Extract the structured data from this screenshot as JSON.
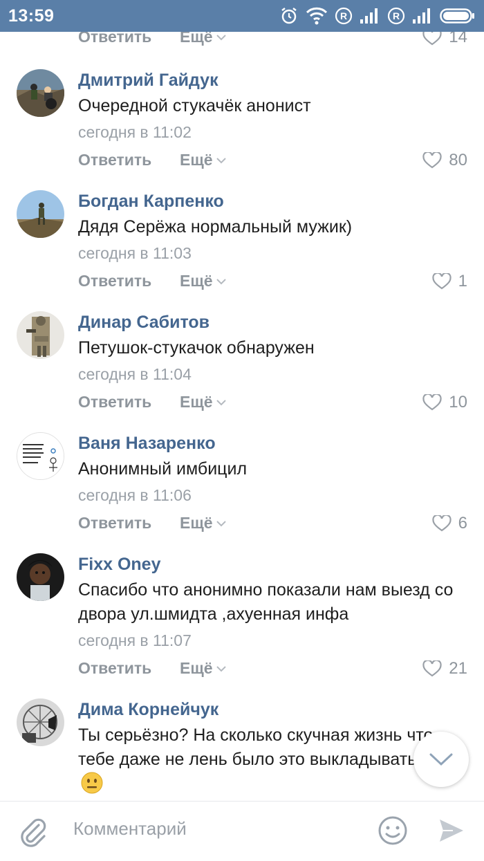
{
  "status_bar": {
    "time": "13:59"
  },
  "top_partial": {
    "reply": "Ответить",
    "more": "Ещё",
    "likes": "14"
  },
  "comments": [
    {
      "author": "Дмитрий Гайдук",
      "text": "Очередной стукачёк анонист",
      "date": "сегодня в 11:02",
      "reply": "Ответить",
      "more": "Ещё",
      "likes": "80"
    },
    {
      "author": "Богдан Карпенко",
      "text": "Дядя Серёжа нормальный мужик)",
      "date": "сегодня в 11:03",
      "reply": "Ответить",
      "more": "Ещё",
      "likes": "1"
    },
    {
      "author": "Динар Сабитов",
      "text": "Петушок-стукачок обнаружен",
      "date": "сегодня в 11:04",
      "reply": "Ответить",
      "more": "Ещё",
      "likes": "10"
    },
    {
      "author": "Ваня Назаренко",
      "text": "Анонимный имбицил",
      "date": "сегодня в 11:06",
      "reply": "Ответить",
      "more": "Ещё",
      "likes": "6"
    },
    {
      "author": "Fixx Oney",
      "text": "Спасибо что анонимно показали нам выезд со двора ул.шмидта ,ахуенная инфа",
      "date": "сегодня в 11:07",
      "reply": "Ответить",
      "more": "Ещё",
      "likes": "21"
    },
    {
      "author": "Дима Корнейчук",
      "text": "Ты серьёзно? На сколько скучная жизнь что тебе даже не лень было это выкладывать"
    }
  ],
  "composer": {
    "placeholder": "Комментарий"
  },
  "colors": {
    "status_bar": "#5a7fa8",
    "author": "#44668f",
    "meta": "#9aa0a7"
  }
}
